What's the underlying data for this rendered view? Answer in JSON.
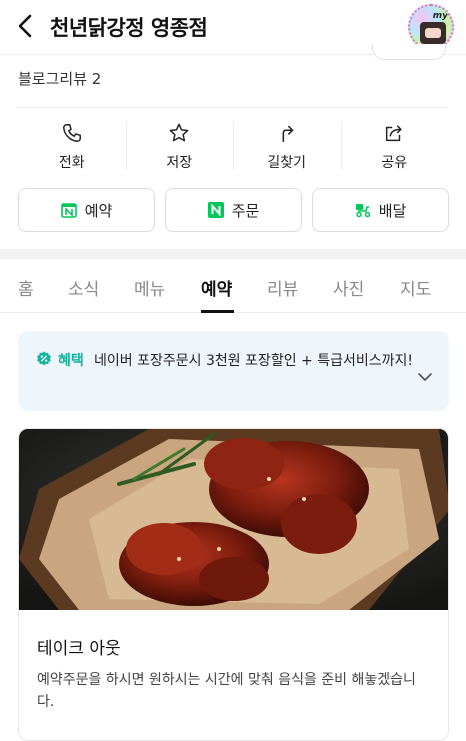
{
  "header": {
    "title": "천년닭강정 영종점",
    "avatar_text": "my"
  },
  "blog_review": "블로그리뷰 2",
  "actions": [
    {
      "label": "전화",
      "icon": "phone-icon"
    },
    {
      "label": "저장",
      "icon": "star-icon"
    },
    {
      "label": "길찾기",
      "icon": "directions-icon"
    },
    {
      "label": "공유",
      "icon": "share-icon"
    }
  ],
  "buttons": [
    {
      "label": "예약",
      "icon": "naver-calendar-icon"
    },
    {
      "label": "주문",
      "icon": "naver-n-icon"
    },
    {
      "label": "배달",
      "icon": "delivery-scooter-icon"
    }
  ],
  "tabs": [
    {
      "label": "홈",
      "active": false
    },
    {
      "label": "소식",
      "active": false
    },
    {
      "label": "메뉴",
      "active": false
    },
    {
      "label": "예약",
      "active": true
    },
    {
      "label": "리뷰",
      "active": false
    },
    {
      "label": "사진",
      "active": false
    },
    {
      "label": "지도",
      "active": false
    }
  ],
  "benefit": {
    "tag": "혜택",
    "text": "네이버 포장주문시 3천원 포장할인 + 특급서비스까지!"
  },
  "card": {
    "title": "테이크 아웃",
    "description": "예약주문을 하시면 원하시는 시간에 맞춰 음식을 준비 해놓겠습니다."
  },
  "colors": {
    "naver_green": "#03c75a",
    "benefit_bg": "#eef6fb",
    "benefit_accent": "#14b39b"
  }
}
